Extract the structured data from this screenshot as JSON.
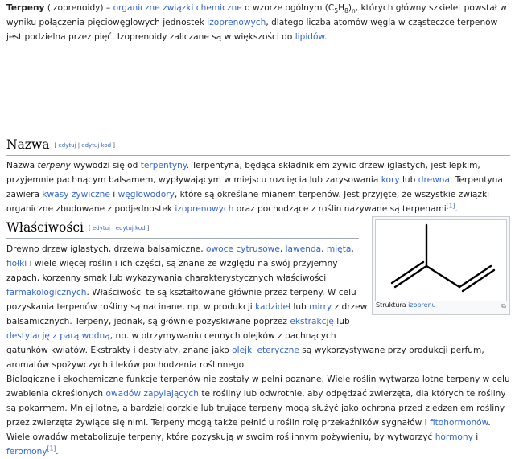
{
  "lead": {
    "term": "Terpeny",
    "alt": " (izoprenoidy) – ",
    "link1": "organiczne",
    "t1": " ",
    "link2": "związki chemiczne",
    "t2": " o wzorze ogólnym (C",
    "sub5": "5",
    "t3": "H",
    "sub8": "8",
    "t4": ")",
    "subn": "n",
    "t5": ", których główny szkielet powstał w wyniku połączenia pięciowęglowych jednostek ",
    "link3": "izoprenowych",
    "t6": ", dlatego liczba atomów węgla w cząsteczce terpenów jest podzielna przez pięć. Izoprenoidy zaliczane są w większości do ",
    "link4": "lipidów",
    "t7": "."
  },
  "edit": {
    "open": "[ ",
    "edit": "edytuj",
    "sep": " | ",
    "editcode": "edytuj kod",
    "close": " ]"
  },
  "nazwa": {
    "heading": "Nazwa",
    "t1": "Nazwa ",
    "em": "terpeny",
    "t2": " wywodzi się od ",
    "l1": "terpentyny",
    "t3": ". Terpentyna, będąca składnikiem żywic drzew iglastych, jest lepkim, przyjemnie pachnącym balsamem, wypływającym w miejscu rozcięcia lub zarysowania ",
    "l2": "kory",
    "t4": " lub ",
    "l3": "drewna",
    "t5": ". Terpentyna zawiera ",
    "l4": "kwasy żywiczne",
    "t6": " i ",
    "l5": "węglowodory",
    "t7": ", które są określane mianem terpenów. Jest przyjęte, że wszystkie związki organiczne zbudowane z podjednostek ",
    "l6": "izoprenowych",
    "t8": " oraz pochodzące z roślin nazywane są terpenami",
    "ref": "[1]",
    "t9": "."
  },
  "wlasciwosci": {
    "heading": "Właściwości",
    "p1": {
      "t1": "Drewno drzew iglastych, drzewa balsamiczne, ",
      "l1": "owoce cytrusowe",
      "t2": ", ",
      "l2": "lawenda",
      "t3": ", ",
      "l3": "mięta",
      "t4": ", ",
      "l4": "fiołki",
      "t5": " i wiele więcej roślin i ich części, są znane ze względu na swój przyjemny zapach, korzenny smak lub wykazywania charakterystycznych właściwości ",
      "l5": "farmakologicznych",
      "t6": ". Właściwości te są kształtowane głównie przez terpeny. W celu pozyskania terpenów rośliny są nacinane, np. w produkcji ",
      "l6": "kadzideł",
      "t7": " lub ",
      "l7": "mirry",
      "t8": " z drzew balsamicznych. Terpeny, jednak, są głównie pozyskiwane poprzez ",
      "l8": "ekstrakcję",
      "t9": " lub ",
      "l9": "destylację z parą wodną",
      "t10": ", np. w otrzymywaniu cennych olejków z pachnących gatunków kwiatów. Ekstrakty i destylaty, znane jako ",
      "l10": "olejki eteryczne",
      "t11": " są wykorzystywane przy produkcji perfum, aromatów spożywczych i leków pochodzenia roślinnego."
    },
    "p2": {
      "t1": "Biologiczne i ekochemiczne funkcje terpenów nie zostały w pełni poznane. Wiele roślin wytwarza lotne terpeny w celu zwabienia określonych ",
      "l1": "owadów zapylających",
      "t2": " te rośliny lub odwrotnie, aby odpędzać zwierzęta, dla których te rośliny są pokarmem. Mniej lotne, a bardziej gorzkie lub trujące terpeny mogą służyć jako ochrona przed zjedzeniem rośliny przez zwierzęta żywiące się nimi. Terpeny mogą także pełnić u roślin rolę przekaźników sygnałów i ",
      "l2": "fitohormonów",
      "t3": "."
    },
    "p3": {
      "t1": "Wiele owadów metabolizuje terpeny, które pozyskują w swoim roślinnym pożywieniu, by wytworzyć ",
      "l1": "hormony",
      "t2": " i ",
      "l2": "feromony",
      "ref": "[1]",
      "t3": "."
    }
  },
  "figure": {
    "caption_prefix": "Struktura ",
    "caption_link": "izoprenu",
    "magnify_icon": "magnify-icon",
    "magnify": "⧉"
  }
}
